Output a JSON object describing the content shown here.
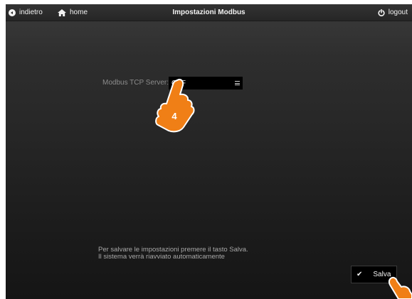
{
  "topbar": {
    "back_label": "indietro",
    "home_label": "home",
    "title": "Impostazioni Modbus",
    "logout_label": "logout"
  },
  "form": {
    "modbus_tcp_label": "Modbus TCP Server:",
    "modbus_tcp_value": "OFF"
  },
  "hint": {
    "line1": "Per salvare le impostazioni premere il tasto Salva.",
    "line2": "Il sistema verrà riavviato automaticamente"
  },
  "save_label": "Salva",
  "annotation": {
    "step": "4"
  },
  "icons": {
    "back": "back-circle-icon",
    "home": "home-icon",
    "logout": "power-icon",
    "dropdown": "menu-icon",
    "save": "check-icon",
    "pointer": "hand-pointer-icon"
  },
  "colors": {
    "accent": "#f07f16",
    "select_bg": "#000000",
    "text": "#f2f2f2"
  }
}
